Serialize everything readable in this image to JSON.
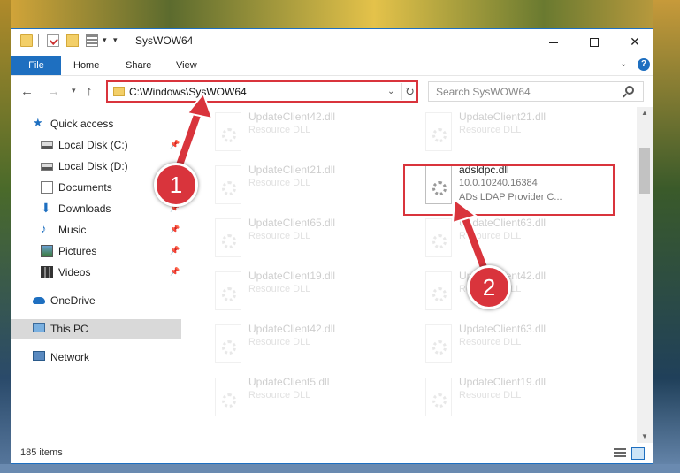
{
  "window": {
    "title": "SysWOW64"
  },
  "ribbon": {
    "tabs": [
      "File",
      "Home",
      "Share",
      "View"
    ],
    "help": "?"
  },
  "address": {
    "path": "C:\\Windows\\SysWOW64",
    "search_placeholder": "Search SysWOW64"
  },
  "nav": {
    "items": [
      {
        "label": "Quick access",
        "icon": "star-icon"
      },
      {
        "label": "Local Disk (C:)",
        "icon": "disk-icon",
        "pinned": true
      },
      {
        "label": "Local Disk (D:)",
        "icon": "disk-icon"
      },
      {
        "label": "Documents",
        "icon": "documents-icon"
      },
      {
        "label": "Downloads",
        "icon": "download-icon",
        "pinned": true
      },
      {
        "label": "Music",
        "icon": "music-icon",
        "pinned": true
      },
      {
        "label": "Pictures",
        "icon": "pictures-icon",
        "pinned": true
      },
      {
        "label": "Videos",
        "icon": "videos-icon",
        "pinned": true
      },
      {
        "label": "OneDrive",
        "icon": "onedrive-icon"
      },
      {
        "label": "This PC",
        "icon": "computer-icon",
        "selected": true
      },
      {
        "label": "Network",
        "icon": "network-icon"
      }
    ]
  },
  "files": [
    {
      "name": "UpdateClient42.dll",
      "desc": "Resource DLL"
    },
    {
      "name": "UpdateClient21.dll",
      "desc": "Resource DLL"
    },
    {
      "name": "UpdateClient21.dll",
      "desc": "Resource DLL"
    },
    {
      "name": "adsldpc.dll",
      "desc": "10.0.10240.16384",
      "extra": "ADs LDAP Provider C..."
    },
    {
      "name": "UpdateClient65.dll",
      "desc": "Resource DLL"
    },
    {
      "name": "UpdateClient63.dll",
      "desc": "Resource DLL"
    },
    {
      "name": "UpdateClient19.dll",
      "desc": "Resource DLL"
    },
    {
      "name": "UpdateClient42.dll",
      "desc": "Resource DLL"
    },
    {
      "name": "UpdateClient42.dll",
      "desc": "Resource DLL"
    },
    {
      "name": "UpdateClient63.dll",
      "desc": "Resource DLL"
    },
    {
      "name": "UpdateClient5.dll",
      "desc": "Resource DLL"
    },
    {
      "name": "UpdateClient19.dll",
      "desc": "Resource DLL"
    }
  ],
  "annotations": {
    "step1": "1",
    "step2": "2",
    "color": "#d9343c"
  },
  "status": {
    "count": "185 items"
  }
}
